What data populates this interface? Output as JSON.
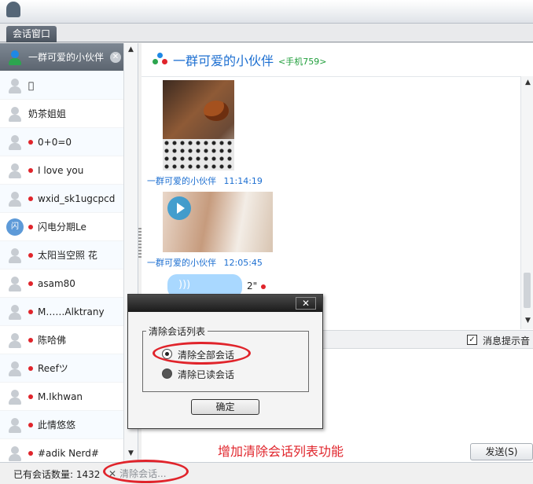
{
  "tabs": {
    "session": "会话窗口"
  },
  "contacts": [
    {
      "name": "一群可爱的小伙伴",
      "avatar": "group",
      "unread": false,
      "active": true
    },
    {
      "name": "",
      "avatar": "person",
      "unread": false
    },
    {
      "name": "奶茶姐姐",
      "avatar": "person",
      "unread": false
    },
    {
      "name": "0+0=0",
      "avatar": "person",
      "unread": true
    },
    {
      "name": "I love you",
      "avatar": "person",
      "unread": true
    },
    {
      "name": "wxid_sk1ugcpcd",
      "avatar": "person",
      "unread": true
    },
    {
      "name": "闪电分期Le",
      "avatar": "bluebubble",
      "unread": true
    },
    {
      "name": "太阳当空照 花",
      "avatar": "person",
      "unread": true
    },
    {
      "name": "asam80",
      "avatar": "person",
      "unread": true
    },
    {
      "name": "M……Alktrany",
      "avatar": "person",
      "unread": true
    },
    {
      "name": "陈哈佛",
      "avatar": "person",
      "unread": true
    },
    {
      "name": "Reefツ",
      "avatar": "person",
      "unread": true
    },
    {
      "name": "M.Ikhwan",
      "avatar": "person",
      "unread": true
    },
    {
      "name": "此情悠悠",
      "avatar": "person",
      "unread": true
    },
    {
      "name": "#adik Nerd#",
      "avatar": "person",
      "unread": true
    }
  ],
  "chat": {
    "title": "一群可爱的小伙伴",
    "subtitle": "<手机759>",
    "messages": [
      {
        "sender": "一群可爱的小伙伴",
        "time": "11:14:19"
      },
      {
        "sender": "一群可爱的小伙伴",
        "time": "12:05:45"
      }
    ],
    "voice_duration": "2\"",
    "notify_label": "消息提示音",
    "send_label": "发送(S)"
  },
  "dialog": {
    "group_label": "清除会话列表",
    "option_all": "清除全部会话",
    "option_read": "清除已读会话",
    "ok_label": "确定"
  },
  "annotation": "增加清除会话列表功能",
  "status": {
    "session_count": "已有会话数量: 1432",
    "clear_label": "清除会话..."
  },
  "colors": {
    "accent": "#1d6fd1",
    "annotation": "#e0242b",
    "unread_dot": "#e0242b"
  }
}
